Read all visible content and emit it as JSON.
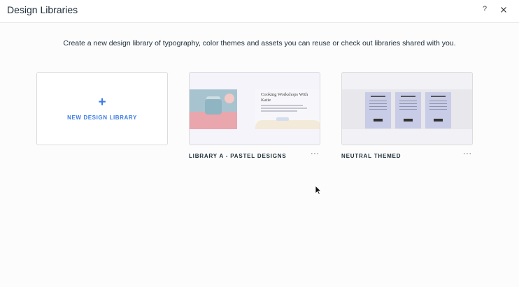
{
  "dialog": {
    "title": "Design Libraries",
    "help_label": "?",
    "subtitle": "Create a new design library of typography, color themes and assets you can reuse or check out libraries shared with you."
  },
  "new_library": {
    "plus": "+",
    "label": "NEW DESIGN LIBRARY"
  },
  "libraries": [
    {
      "name": "LIBRARY A - PASTEL DESIGNS",
      "menu": "···",
      "preview_heading": "Cooking Workshops With Katie"
    },
    {
      "name": "NEUTRAL THEMED",
      "menu": "···"
    }
  ],
  "colors": {
    "accent": "#3b7be6",
    "text": "#20303c"
  },
  "icons": [
    "help-icon",
    "close-icon",
    "plus-icon",
    "more-options-icon",
    "mouse-cursor-icon"
  ]
}
